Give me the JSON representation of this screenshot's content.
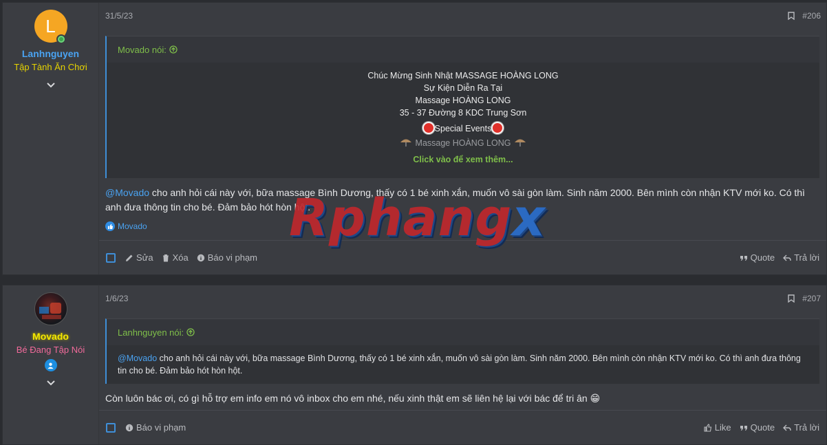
{
  "posts": [
    {
      "avatar_letter": "L",
      "username": "Lanhnguyen",
      "user_title": "Tập Tành Ăn Chơi",
      "date": "31/5/23",
      "post_number": "#206",
      "quote": {
        "author": "Movado nói:",
        "lines": [
          "Chúc Mừng Sinh Nhật MASSAGE HOÀNG LONG",
          "Sự Kiện Diễn Ra Tại",
          "Massage HOÀNG LONG",
          "35 - 37 Đường 8 KDC Trung Sơn",
          "Special Events",
          "Massage HOÀNG LONG"
        ],
        "click_more": "Click vào để xem thêm..."
      },
      "message_mention": "@Movado",
      "message_text": " cho anh hỏi cái này với, bữa massage Bình Dương, thấy có 1 bé xinh xắn, muốn vô sài gòn làm. Sinh năm 2000. Bên mình còn nhận KTV mới ko. Có thì anh đưa thông tin cho bé. Đảm bảo hót hòn hột.",
      "reaction_user": "Movado",
      "actions": {
        "edit": "Sửa",
        "delete": "Xóa",
        "report": "Báo vi phạm",
        "quote": "Quote",
        "reply": "Trả lời"
      }
    },
    {
      "username": "Movado",
      "user_title": "Bé Đang Tập Nói",
      "date": "1/6/23",
      "post_number": "#207",
      "quote": {
        "author": "Lanhnguyen nói:",
        "mention": "@Movado",
        "text": " cho anh hỏi cái này với, bữa massage Bình Dương, thấy có 1 bé xinh xắn, muốn vô sài gòn làm. Sinh năm 2000. Bên mình còn nhận KTV mới ko. Có thì anh đưa thông tin cho bé. Đảm bảo hót hòn hột."
      },
      "message_text": "Còn luôn bác ơi, có gì hỗ trợ em info em nó vô inbox cho em nhé, nếu xinh thật em sẽ liên hệ lại với bác để tri ân 😁",
      "actions": {
        "report": "Báo vi phạm",
        "like": "Like",
        "quote": "Quote",
        "reply": "Trả lời"
      }
    }
  ],
  "watermark": {
    "part1": "Rphang",
    "part2": "x"
  },
  "colors": {
    "accent_blue": "#3f8fd8",
    "quote_green": "#7fbf4a",
    "mention_blue": "#4aa3f2",
    "avatar_orange": "#f5a623"
  }
}
